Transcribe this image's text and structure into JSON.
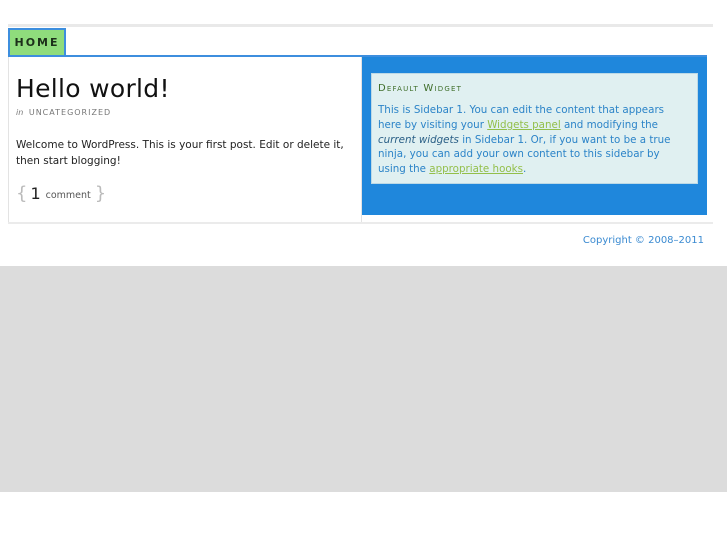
{
  "nav": {
    "items": [
      {
        "label": "HOME"
      }
    ]
  },
  "post": {
    "title": "Hello world!",
    "meta_prefix": "in",
    "category": "UNCATEGORIZED",
    "body": "Welcome to WordPress. This is your first post. Edit or delete it, then start blogging!",
    "comment_open": "{",
    "comment_count": "1",
    "comment_label": "comment",
    "comment_close": "}"
  },
  "sidebar": {
    "widget": {
      "title": "Default Widget",
      "text_1": "This is Sidebar 1. You can edit the content that appears here by visiting your ",
      "link_1": "Widgets panel",
      "text_2": " and modifying the ",
      "em_1": "current widgets",
      "text_3": " in Sidebar 1. Or, if you want to be a true ninja, you can add your own content to this sidebar by using the ",
      "link_2": "appropriate hooks",
      "text_4": "."
    }
  },
  "footer": {
    "copyright": "Copyright © 2008–2011"
  },
  "colors": {
    "accent": "#1f87dc",
    "tab_bg": "#8fdc7c",
    "link": "#93bf4a",
    "background_band": "#dcdcdc"
  }
}
